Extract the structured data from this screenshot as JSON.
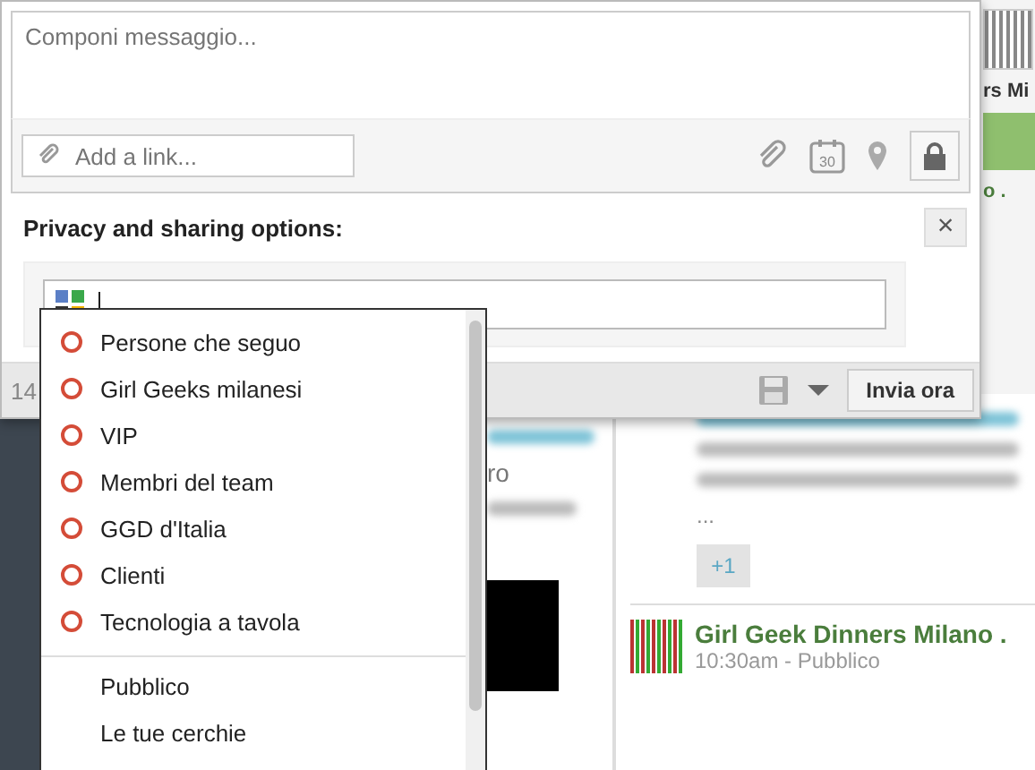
{
  "composer": {
    "placeholder": "Componi messaggio...",
    "link_placeholder": "Add a link...",
    "calendar_day": "30",
    "privacy_title": "Privacy and sharing options:",
    "close": "×",
    "count": "14",
    "send_button": "Invia ora"
  },
  "audience_menu": [
    {
      "kind": "circle",
      "label": "Persone che seguo"
    },
    {
      "kind": "circle",
      "label": "Girl Geeks milanesi"
    },
    {
      "kind": "circle",
      "label": "VIP"
    },
    {
      "kind": "circle",
      "label": "Membri del team"
    },
    {
      "kind": "circle",
      "label": "GGD d'Italia"
    },
    {
      "kind": "circle",
      "label": "Clienti"
    },
    {
      "kind": "circle",
      "label": "Tecnologia a tavola"
    },
    {
      "kind": "plain",
      "label": "Pubblico"
    },
    {
      "kind": "plain",
      "label": "Le tue cerchie"
    }
  ],
  "background": {
    "peek_title": "rs Mi",
    "peek_author": "o .",
    "middle_peek": "ro",
    "ellipsis": "...",
    "plus_one": "+1",
    "post": {
      "author": "Girl Geek Dinners Milano .",
      "meta": "10:30am - Pubblico"
    }
  }
}
